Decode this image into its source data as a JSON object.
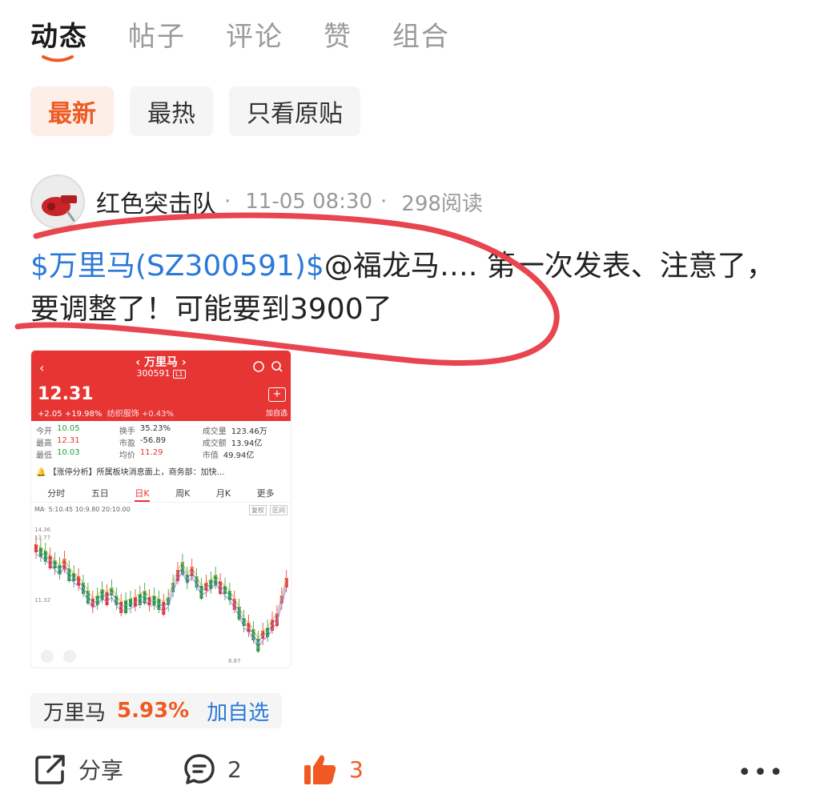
{
  "tabs": [
    {
      "label": "动态",
      "active": true
    },
    {
      "label": "帖子",
      "active": false
    },
    {
      "label": "评论",
      "active": false
    },
    {
      "label": "赞",
      "active": false
    },
    {
      "label": "组合",
      "active": false
    }
  ],
  "filters": [
    {
      "label": "最新",
      "active": true
    },
    {
      "label": "最热",
      "active": false
    },
    {
      "label": "只看原贴",
      "active": false
    }
  ],
  "post": {
    "author": "红色突击队",
    "time": "11-05 08:30",
    "reads": "298阅读",
    "stock_link": "$万里马(SZ300591)$",
    "text": "@福龙马…. 第一次发表、注意了，要调整了！可能要到3900了"
  },
  "thumbnail": {
    "back": "‹",
    "name": "‹ 万里马 ›",
    "code": "300591",
    "code_badge": "L1",
    "price": "12.31",
    "change": "+2.05  +19.98%",
    "sector": "纺织服饰 +0.43%",
    "add_label": "加自选",
    "stats": [
      [
        {
          "k": "今开",
          "v": "10.05",
          "c": "green"
        },
        {
          "k": "换手",
          "v": "35.23%",
          "c": ""
        },
        {
          "k": "成交量",
          "v": "123.46万",
          "c": ""
        }
      ],
      [
        {
          "k": "最高",
          "v": "12.31",
          "c": "red"
        },
        {
          "k": "市盈",
          "v": "-56.89",
          "c": ""
        },
        {
          "k": "成交额",
          "v": "13.94亿",
          "c": ""
        }
      ],
      [
        {
          "k": "最低",
          "v": "10.03",
          "c": "green"
        },
        {
          "k": "均价",
          "v": "11.29",
          "c": "red"
        },
        {
          "k": "市值",
          "v": "49.94亿",
          "c": ""
        }
      ]
    ],
    "news": "【涨停分析】所属板块消息面上，商务部：加快…",
    "periods": [
      "分时",
      "五日",
      "日K",
      "周K",
      "月K",
      "更多"
    ],
    "active_period": "日K",
    "ma": "MA· 5:10.45  10:9.80  20:10.00",
    "ma_btns": [
      "复权",
      "区间"
    ],
    "chart_labels": {
      "high": "14.36",
      "mark": "13.77",
      "mid": "11.32",
      "low": "8.87"
    }
  },
  "stock_tag": {
    "name": "万里马",
    "pct": "5.93%",
    "add": "加自选"
  },
  "actions": {
    "share": "分享",
    "comments": "2",
    "likes": "3",
    "more": "•••"
  },
  "colors": {
    "accent": "#f05a22",
    "link": "#2a79d8",
    "like": "#f05a22",
    "annotation": "#e8454f",
    "phone_red": "#e63533"
  }
}
